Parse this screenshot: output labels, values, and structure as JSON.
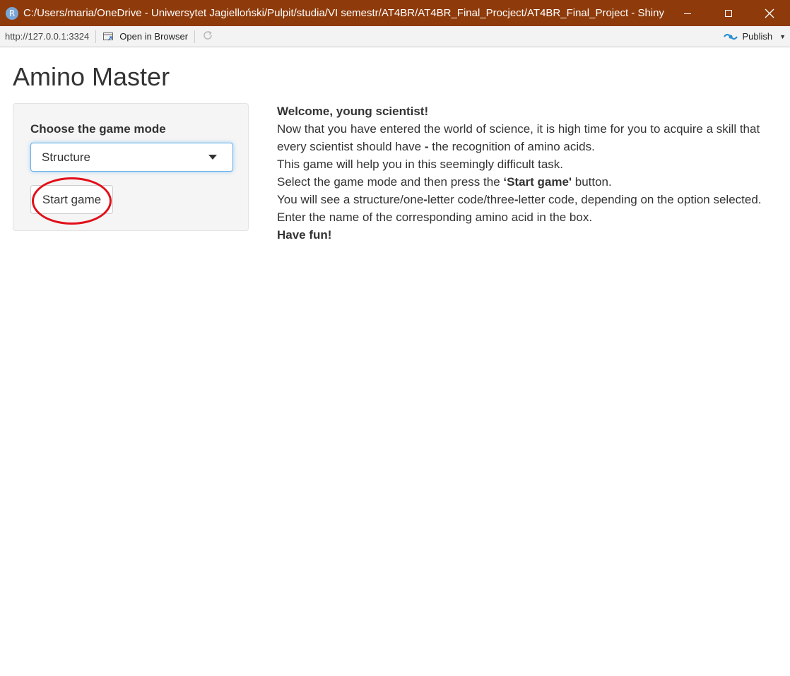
{
  "window": {
    "title": "C:/Users/maria/OneDrive - Uniwersytet Jagielloński/Pulpit/studia/VI semestr/AT4BR/AT4BR_Final_Procject/AT4BR_Final_Project - Shiny",
    "icon_letter": "R",
    "controls": [
      "minimize-icon",
      "maximize-icon",
      "close-icon"
    ]
  },
  "toolbar": {
    "url": "http://127.0.0.1:3324",
    "open_browser_label": "Open in Browser",
    "publish_label": "Publish"
  },
  "app": {
    "title": "Amino Master",
    "sidebar": {
      "mode_label": "Choose the game mode",
      "selected_mode": "Structure",
      "start_button_label": "Start game"
    },
    "welcome": {
      "heading": "Welcome, young scientist!",
      "line2a": "Now that you have entered the world of science, it is high time for you to acquire a skill that every scientist should have ",
      "line2dash": "-",
      "line2b": " the recognition of amino acids.",
      "line3": "This game will help you in this seemingly difficult task.",
      "line4a": "Select the game mode and then press the ",
      "line4bold": "‘Start game'",
      "line4b": " button.",
      "line5a": "You will see a structure/one",
      "line5dash1": "-",
      "line5b": "letter code/three",
      "line5dash2": "-",
      "line5c": "letter code, depending on the option selected.",
      "line6": "Enter the name of the corresponding amino acid in the box.",
      "closing": "Have fun!"
    }
  },
  "colors": {
    "titlebar": "#8e3a0a",
    "annotation_circle": "#e0101a",
    "focus_border": "#66afe9"
  }
}
